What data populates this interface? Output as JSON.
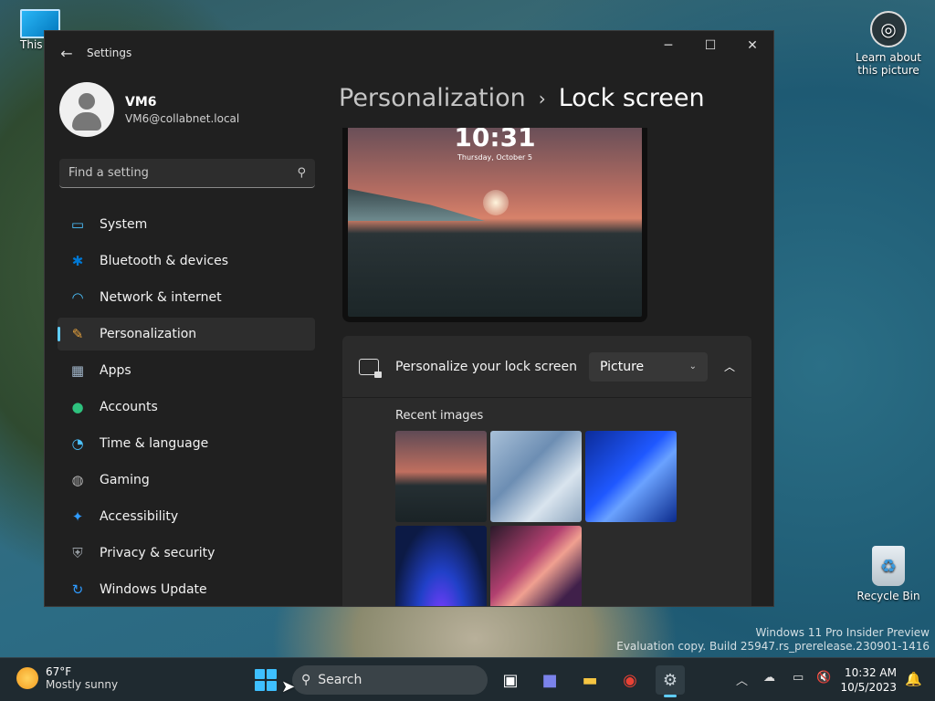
{
  "desktop": {
    "this_pc_label": "This PC",
    "learn_label": "Learn about this picture",
    "recycle_label": "Recycle Bin",
    "watermark_line1": "Windows 11 Pro Insider Preview",
    "watermark_line2": "Evaluation copy. Build 25947.rs_prerelease.230901-1416"
  },
  "window": {
    "title": "Settings",
    "minimize": "─",
    "maximize": "☐",
    "close": "✕"
  },
  "profile": {
    "name": "VM6",
    "email": "VM6@collabnet.local"
  },
  "search": {
    "placeholder": "Find a setting"
  },
  "nav": [
    {
      "label": "System",
      "icon": "system-icon",
      "color": "#4cc2ff"
    },
    {
      "label": "Bluetooth & devices",
      "icon": "bluetooth-icon",
      "color": "#0078d4"
    },
    {
      "label": "Network & internet",
      "icon": "wifi-icon",
      "color": "#4cc2ff"
    },
    {
      "label": "Personalization",
      "icon": "brush-icon",
      "color": "#e8a33d"
    },
    {
      "label": "Apps",
      "icon": "apps-icon",
      "color": "#a0b4c8"
    },
    {
      "label": "Accounts",
      "icon": "accounts-icon",
      "color": "#2ec27e"
    },
    {
      "label": "Time & language",
      "icon": "clock-globe-icon",
      "color": "#4cc2ff"
    },
    {
      "label": "Gaming",
      "icon": "gamepad-icon",
      "color": "#b0b0b0"
    },
    {
      "label": "Accessibility",
      "icon": "accessibility-icon",
      "color": "#2f9bff"
    },
    {
      "label": "Privacy & security",
      "icon": "shield-icon",
      "color": "#9aa0a6"
    },
    {
      "label": "Windows Update",
      "icon": "update-icon",
      "color": "#2f9bff"
    }
  ],
  "active_nav": "Personalization",
  "breadcrumb": {
    "parent": "Personalization",
    "separator": "›",
    "current": "Lock screen"
  },
  "preview": {
    "time": "10:31",
    "date": "Thursday, October 5"
  },
  "lock_panel": {
    "title": "Personalize your lock screen",
    "dropdown_value": "Picture",
    "recent_label": "Recent images"
  },
  "taskbar": {
    "temp": "67°F",
    "condition": "Mostly sunny",
    "search_label": "Search",
    "time": "10:32 AM",
    "date": "10/5/2023"
  }
}
